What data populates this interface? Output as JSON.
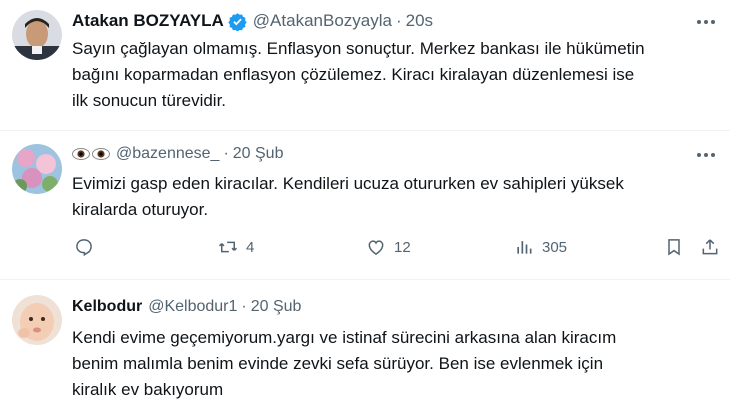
{
  "tweets": [
    {
      "name": "Atakan BOZYAYLA",
      "handle": "@AtakanBozyayla",
      "time": "20s",
      "text_lines": [
        "Sayın çağlayan olmamış. Enflasyon sonuçtur. Merkez bankası ile hükümetin",
        "bağını koparmadan enflasyon çözülemez. Kiracı kiralayan düzenlemesi ise",
        "ilk sonucun türevidir."
      ]
    },
    {
      "handle": "@bazennese_",
      "time": "20 Şub",
      "text_lines": [
        "Evimizi gasp eden kiracılar. Kendileri ucuza otururken ev sahipleri yüksek",
        "kiralarda oturuyor."
      ],
      "retweets": "4",
      "likes": "12",
      "views": "305"
    },
    {
      "name": "Kelbodur",
      "handle": "@Kelbodur1",
      "time": "20 Şub",
      "text_lines": [
        "Kendi evime geçemiyorum.yargı ve istinaf sürecini arkasına alan kiracım",
        "benim malımla benim evinde zevki sefa sürüyor. Ben ise evlenmek için",
        "kiralık ev bakıyorum"
      ]
    }
  ],
  "colors": {
    "text": "#0f1419",
    "secondary": "#536471",
    "verified": "#1d9bf0",
    "divider": "#eff3f4"
  },
  "icons": [
    "more-icon",
    "verified-badge-icon",
    "eyes-emoji-icon",
    "reply-icon",
    "retweet-icon",
    "like-icon",
    "views-icon",
    "bookmark-icon",
    "share-icon"
  ]
}
